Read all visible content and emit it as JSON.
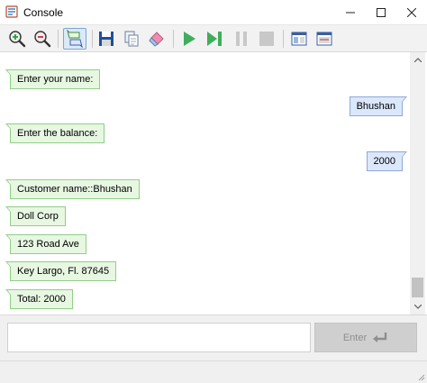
{
  "window": {
    "title": "Console"
  },
  "toolbar": {
    "buttons": [
      {
        "icon": "zoom-in-icon"
      },
      {
        "icon": "zoom-out-icon"
      },
      {
        "icon": "toggle-view-icon",
        "selected": true
      },
      {
        "icon": "save-icon"
      },
      {
        "icon": "copy-icon"
      },
      {
        "icon": "eraser-icon"
      },
      {
        "icon": "run-icon"
      },
      {
        "icon": "step-icon"
      },
      {
        "icon": "pause-icon"
      },
      {
        "icon": "stop-icon"
      },
      {
        "icon": "layout-split-icon"
      },
      {
        "icon": "layout-window-icon"
      }
    ]
  },
  "console": {
    "messages": [
      {
        "type": "output",
        "text": "Enter your name:"
      },
      {
        "type": "input",
        "text": "Bhushan"
      },
      {
        "type": "output",
        "text": "Enter the balance:"
      },
      {
        "type": "input",
        "text": "2000"
      },
      {
        "type": "output",
        "text": "Customer name::Bhushan"
      },
      {
        "type": "output",
        "text": "Doll Corp"
      },
      {
        "type": "output",
        "text": "123 Road Ave"
      },
      {
        "type": "output",
        "text": "Key Largo, Fl. 87645"
      },
      {
        "type": "output",
        "text": "Total: 2000"
      }
    ]
  },
  "input": {
    "value": "",
    "enter_label": "Enter"
  },
  "colors": {
    "output_bubble": "#e7f7e2",
    "input_bubble": "#dbe7fb",
    "run_green": "#3fae5a"
  }
}
